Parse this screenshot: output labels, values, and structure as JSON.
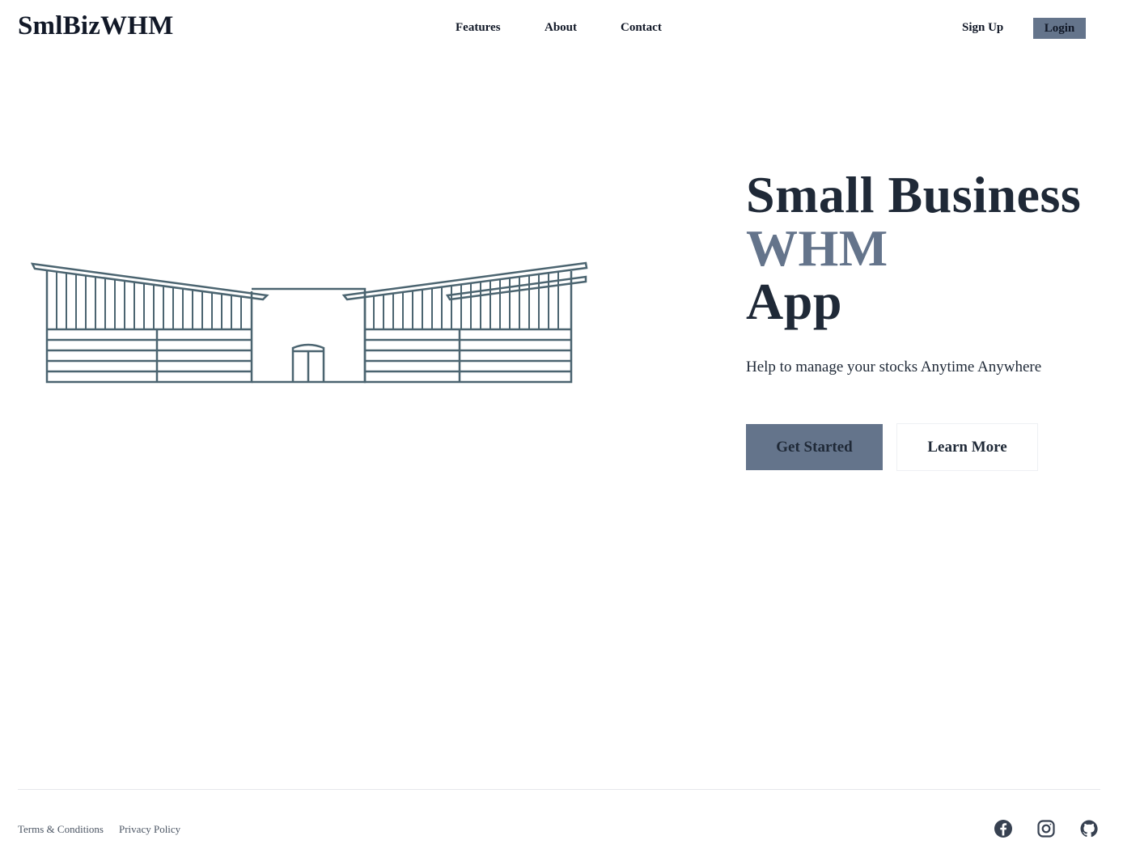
{
  "brand": {
    "name": "SmlBizWHM"
  },
  "nav": {
    "items": [
      {
        "label": "Features"
      },
      {
        "label": "About"
      },
      {
        "label": "Contact"
      }
    ],
    "signup_label": "Sign Up",
    "login_label": "Login"
  },
  "hero": {
    "title_line1": "Small Business",
    "title_accent": "WHM",
    "title_line3": "App",
    "subtitle": "Help to manage your stocks Anytime Anywhere",
    "primary_button": "Get Started",
    "secondary_button": "Learn More"
  },
  "footer": {
    "links": [
      {
        "label": "Terms & Conditions"
      },
      {
        "label": "Privacy Policy"
      }
    ],
    "social": [
      "facebook-icon",
      "instagram-icon",
      "github-icon"
    ]
  },
  "colors": {
    "accent": "#64748b",
    "text": "#1f2937",
    "illustration_stroke": "#4b6470"
  }
}
